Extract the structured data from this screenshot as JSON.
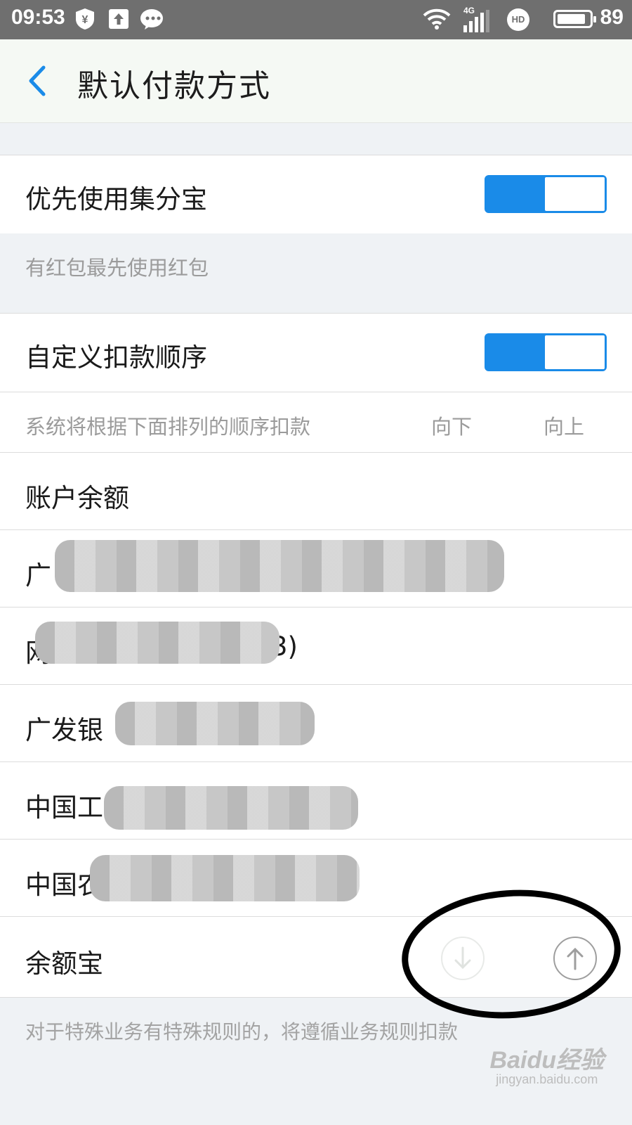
{
  "status_bar": {
    "time": "09:53",
    "battery_level": "89",
    "icons": [
      "yuan-shield-icon",
      "upload-icon",
      "wechat-icon",
      "wifi-icon",
      "signal-4g-icon",
      "hd-icon",
      "battery-icon"
    ],
    "network_label": "4G",
    "hd_label": "HD"
  },
  "nav": {
    "back_icon": "chevron-left-icon",
    "title": "默认付款方式"
  },
  "section_points": {
    "label": "优先使用集分宝",
    "toggle_on": true,
    "hint": "有红包最先使用红包"
  },
  "section_custom_order": {
    "label": "自定义扣款顺序",
    "toggle_on": true,
    "hint": "系统将根据下面排列的顺序扣款",
    "col_down": "向下",
    "col_up": "向上"
  },
  "payment_methods": [
    {
      "label": "账户余额"
    },
    {
      "label": "广",
      "blurred": true
    },
    {
      "label": "网",
      "suffix": "3)",
      "blurred": true
    },
    {
      "label": "广发银",
      "blurred": true
    },
    {
      "label": "中国工",
      "blurred": true
    },
    {
      "label": "中国农",
      "blurred": true
    },
    {
      "label": "余额宝",
      "down_icon": "arrow-down-circle-icon",
      "up_icon": "arrow-up-circle-icon",
      "down_enabled": false,
      "up_enabled": true
    }
  ],
  "footer_note": "对于特殊业务有特殊规则的，将遵循业务规则扣款",
  "watermark": {
    "main": "Baidu经验",
    "sub": "jingyan.baidu.com"
  },
  "colors": {
    "accent": "#1a8be8",
    "hint_text": "#9b9b9b",
    "page_bg": "#eff2f5"
  }
}
